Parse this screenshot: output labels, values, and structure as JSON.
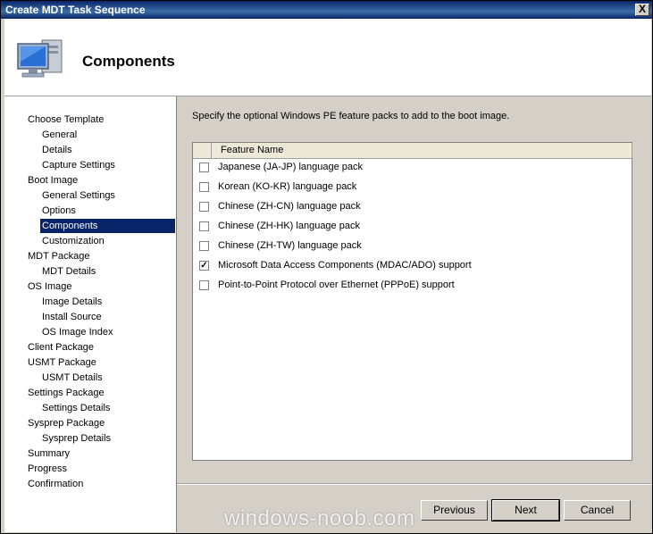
{
  "window": {
    "title": "Create MDT Task Sequence",
    "close_label": "X"
  },
  "header": {
    "title": "Components",
    "icon": "computer-monitor-icon"
  },
  "nav": {
    "items": [
      {
        "label": "Choose Template",
        "level": 0
      },
      {
        "label": "General",
        "level": 1
      },
      {
        "label": "Details",
        "level": 1
      },
      {
        "label": "Capture Settings",
        "level": 1
      },
      {
        "label": "Boot Image",
        "level": 0
      },
      {
        "label": "General Settings",
        "level": 1
      },
      {
        "label": "Options",
        "level": 1
      },
      {
        "label": "Components",
        "level": 1,
        "selected": true
      },
      {
        "label": "Customization",
        "level": 1
      },
      {
        "label": "MDT Package",
        "level": 0
      },
      {
        "label": "MDT Details",
        "level": 1
      },
      {
        "label": "OS Image",
        "level": 0
      },
      {
        "label": "Image Details",
        "level": 1
      },
      {
        "label": "Install Source",
        "level": 1
      },
      {
        "label": "OS Image Index",
        "level": 1
      },
      {
        "label": "Client Package",
        "level": 0
      },
      {
        "label": "USMT Package",
        "level": 0
      },
      {
        "label": "USMT Details",
        "level": 1
      },
      {
        "label": "Settings Package",
        "level": 0
      },
      {
        "label": "Settings Details",
        "level": 1
      },
      {
        "label": "Sysprep Package",
        "level": 0
      },
      {
        "label": "Sysprep Details",
        "level": 1
      },
      {
        "label": "Summary",
        "level": 0
      },
      {
        "label": "Progress",
        "level": 0
      },
      {
        "label": "Confirmation",
        "level": 0
      }
    ]
  },
  "main": {
    "instructions": "Specify the optional Windows PE feature packs to add to the boot image.",
    "list": {
      "column_header": "Feature Name",
      "rows": [
        {
          "label": "Japanese (JA-JP) language pack",
          "checked": false
        },
        {
          "label": "Korean (KO-KR) language pack",
          "checked": false
        },
        {
          "label": "Chinese (ZH-CN) language pack",
          "checked": false
        },
        {
          "label": "Chinese (ZH-HK) language pack",
          "checked": false
        },
        {
          "label": "Chinese (ZH-TW) language pack",
          "checked": false
        },
        {
          "label": "Microsoft Data Access Components (MDAC/ADO) support",
          "checked": true
        },
        {
          "label": "Point-to-Point Protocol over Ethernet (PPPoE) support",
          "checked": false
        }
      ]
    }
  },
  "buttons": {
    "previous": "Previous",
    "next": "Next",
    "cancel": "Cancel"
  },
  "watermark": "windows-noob.com",
  "colors": {
    "titlebar": "#0a246a",
    "selection": "#0a246a",
    "face": "#d4d0c8"
  }
}
